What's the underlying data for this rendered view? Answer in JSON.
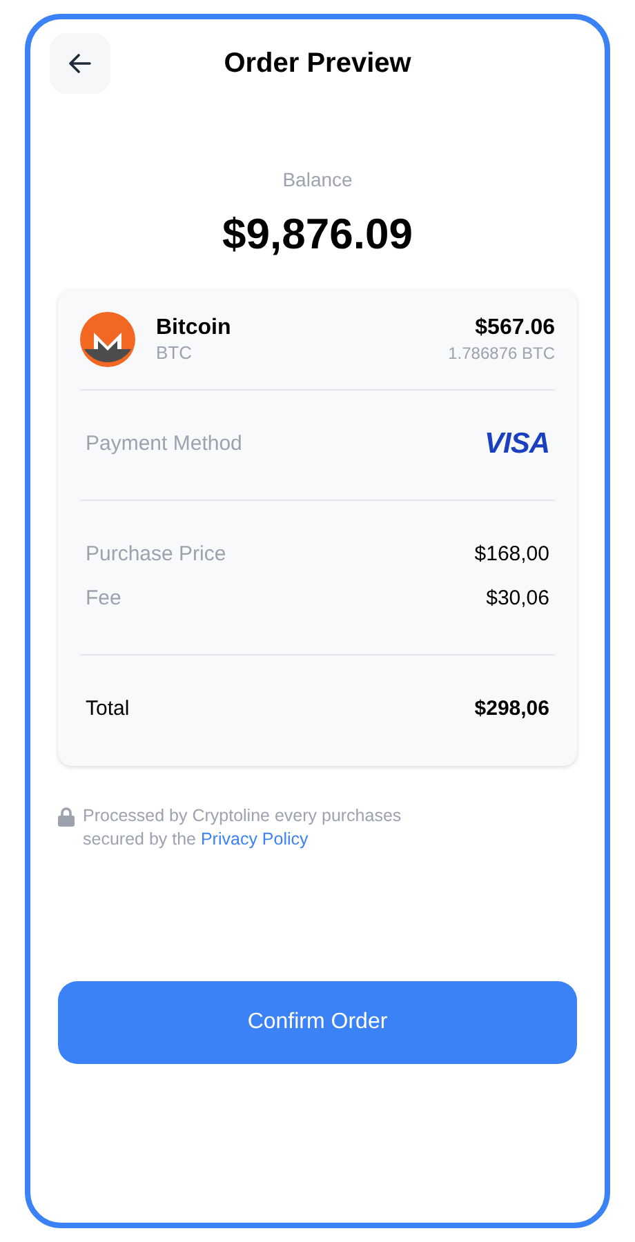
{
  "header": {
    "title": "Order Preview"
  },
  "balance": {
    "label": "Balance",
    "amount": "$9,876.09"
  },
  "asset": {
    "name": "Bitcoin",
    "symbol": "BTC",
    "value": "$567.06",
    "quantity": "1.786876 BTC"
  },
  "payment": {
    "label": "Payment Method",
    "card": "VISA"
  },
  "costs": [
    {
      "label": "Purchase Price",
      "value": "$168,00"
    },
    {
      "label": "Fee",
      "value": "$30,06"
    }
  ],
  "total": {
    "label": "Total",
    "value": "$298,06"
  },
  "notice": {
    "text": "Processed by Cryptoline every purchases secured by the ",
    "link": "Privacy Policy"
  },
  "confirm_button": "Confirm Order"
}
